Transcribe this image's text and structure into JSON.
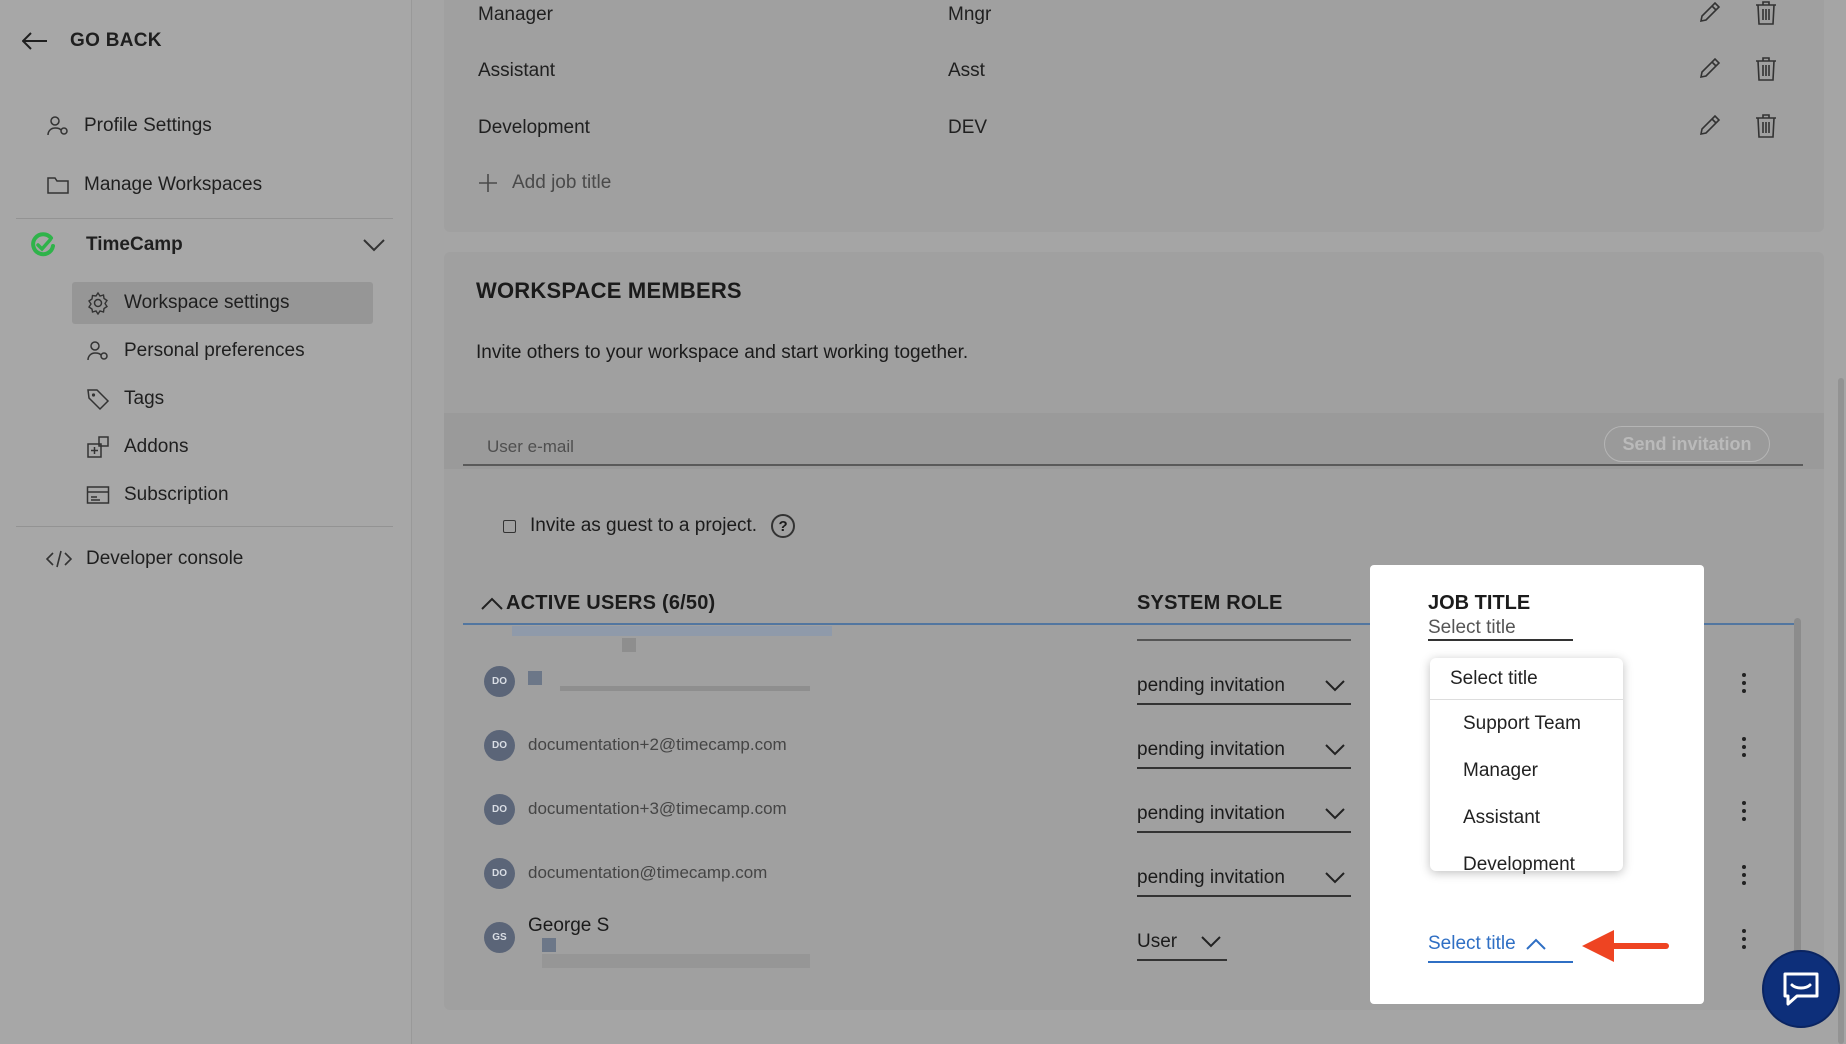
{
  "sidebar": {
    "go_back": "GO BACK",
    "items": [
      {
        "label": "Profile Settings"
      },
      {
        "label": "Manage Workspaces"
      }
    ],
    "workspace_name": "TimeCamp",
    "workspace_items": [
      {
        "label": "Workspace settings"
      },
      {
        "label": "Personal preferences"
      },
      {
        "label": "Tags"
      },
      {
        "label": "Addons"
      },
      {
        "label": "Subscription"
      }
    ],
    "developer_console": "Developer console"
  },
  "job_titles": {
    "rows": [
      {
        "name": "Manager",
        "abbr": "Mngr"
      },
      {
        "name": "Assistant",
        "abbr": "Asst"
      },
      {
        "name": "Development",
        "abbr": "DEV"
      }
    ],
    "add_label": "Add job title"
  },
  "members": {
    "title": "WORKSPACE MEMBERS",
    "description": "Invite others to your workspace and start working together.",
    "email_placeholder": "User e-mail",
    "send_label": "Send invitation",
    "guest_label": "Invite as guest to a project.",
    "help_glyph": "?",
    "columns": {
      "active_users": "ACTIVE USERS (6/50)",
      "system_role": "SYSTEM ROLE",
      "job_title": "JOB TITLE"
    },
    "users": [
      {
        "initials": "DO",
        "email": "",
        "role": "pending invitation"
      },
      {
        "initials": "DO",
        "email": "documentation+2@timecamp.com",
        "role": "pending invitation"
      },
      {
        "initials": "DO",
        "email": "documentation+3@timecamp.com",
        "role": "pending invitation"
      },
      {
        "initials": "DO",
        "email": "documentation@timecamp.com",
        "role": "pending invitation"
      },
      {
        "initials": "GS",
        "email": "George S",
        "role": "User"
      }
    ]
  },
  "job_title_dropdown": {
    "placeholder": "Select title",
    "options": [
      "Support Team",
      "Manager",
      "Assistant",
      "Development"
    ],
    "current_value": "Select title"
  },
  "colors": {
    "accent_blue": "#2f6fc4",
    "arrow_red": "#ee4422",
    "brand_green": "#2fb34a",
    "chat_navy": "#0d2f7a"
  }
}
